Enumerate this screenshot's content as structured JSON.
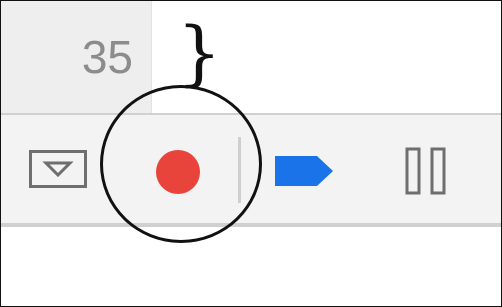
{
  "editor": {
    "line_number": "35",
    "code_text": "}"
  },
  "toolbar": {
    "buttons": [
      {
        "name": "dropdown-toggle",
        "icon": "chevron-down-icon"
      },
      {
        "name": "record",
        "icon": "record-icon",
        "color": "#e8443c"
      },
      {
        "name": "step",
        "icon": "arrow-flag-icon",
        "color": "#1a73e8"
      },
      {
        "name": "pause",
        "icon": "pause-icon",
        "color": "#6e6e6e"
      }
    ]
  },
  "annotation": {
    "shape": "circle",
    "highlights": "record"
  }
}
